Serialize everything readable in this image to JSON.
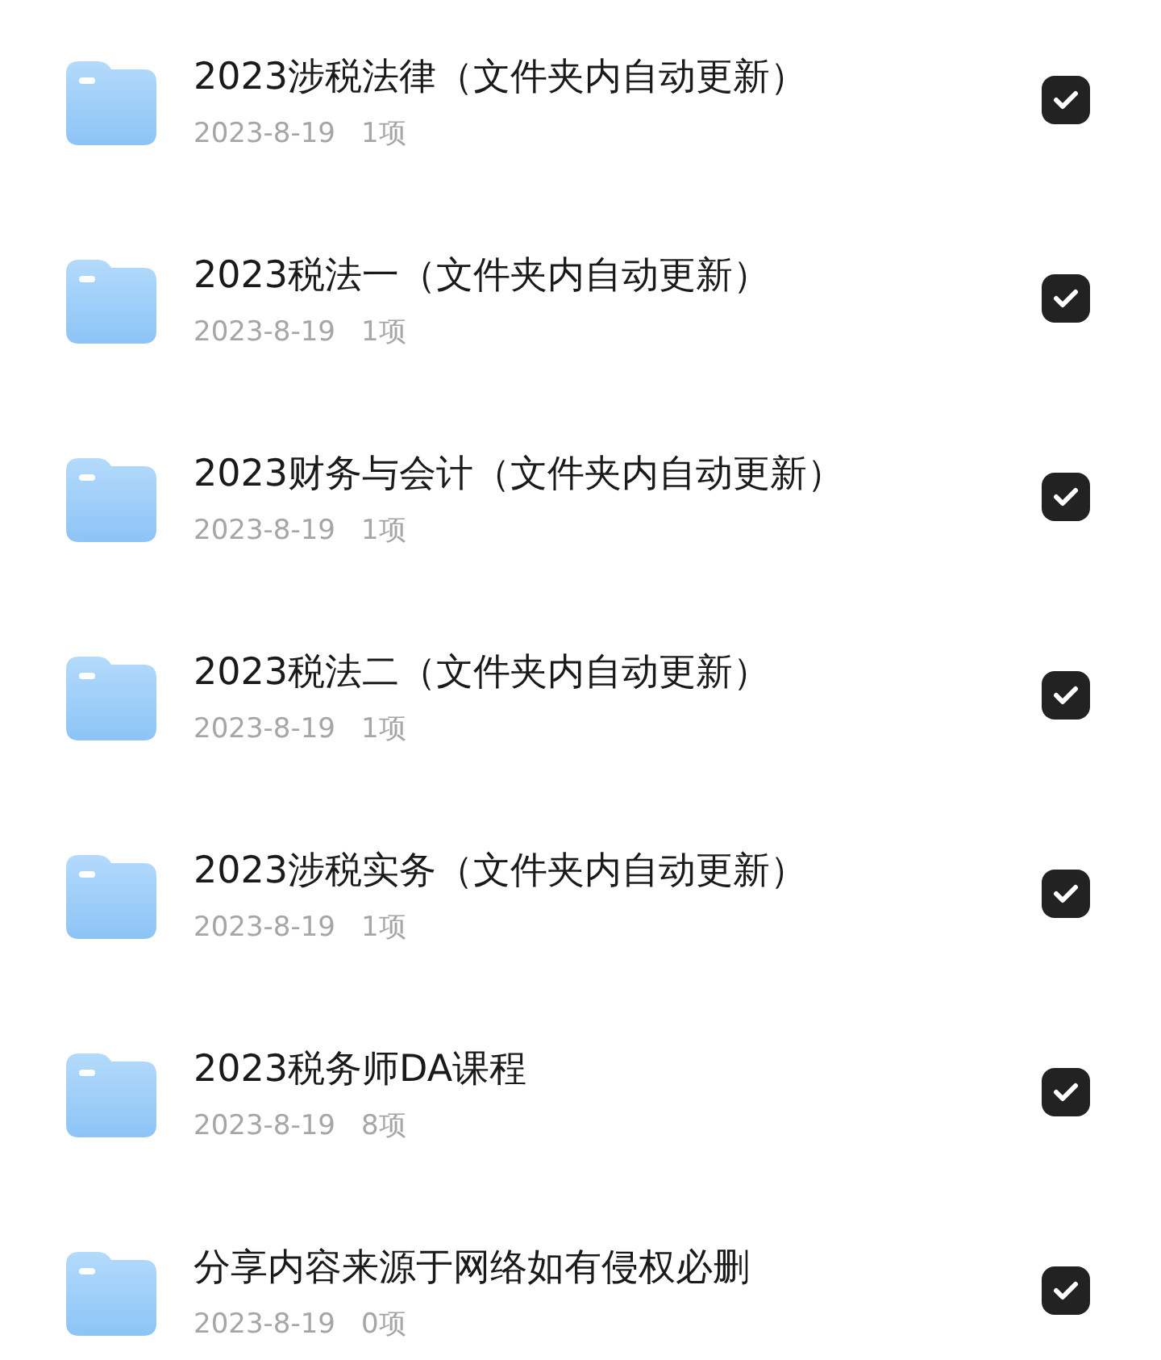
{
  "files": [
    {
      "name": "2023涉税法律（文件夹内自动更新）",
      "date": "2023-8-19",
      "count": "1项",
      "checked": true
    },
    {
      "name": "2023税法一（文件夹内自动更新）",
      "date": "2023-8-19",
      "count": "1项",
      "checked": true
    },
    {
      "name": "2023财务与会计（文件夹内自动更新）",
      "date": "2023-8-19",
      "count": "1项",
      "checked": true
    },
    {
      "name": "2023税法二（文件夹内自动更新）",
      "date": "2023-8-19",
      "count": "1项",
      "checked": true
    },
    {
      "name": "2023涉税实务（文件夹内自动更新）",
      "date": "2023-8-19",
      "count": "1项",
      "checked": true
    },
    {
      "name": "2023税务师DA课程",
      "date": "2023-8-19",
      "count": "8项",
      "checked": true
    },
    {
      "name": "分享内容来源于网络如有侵权必删",
      "date": "2023-8-19",
      "count": "0项",
      "checked": true
    }
  ]
}
